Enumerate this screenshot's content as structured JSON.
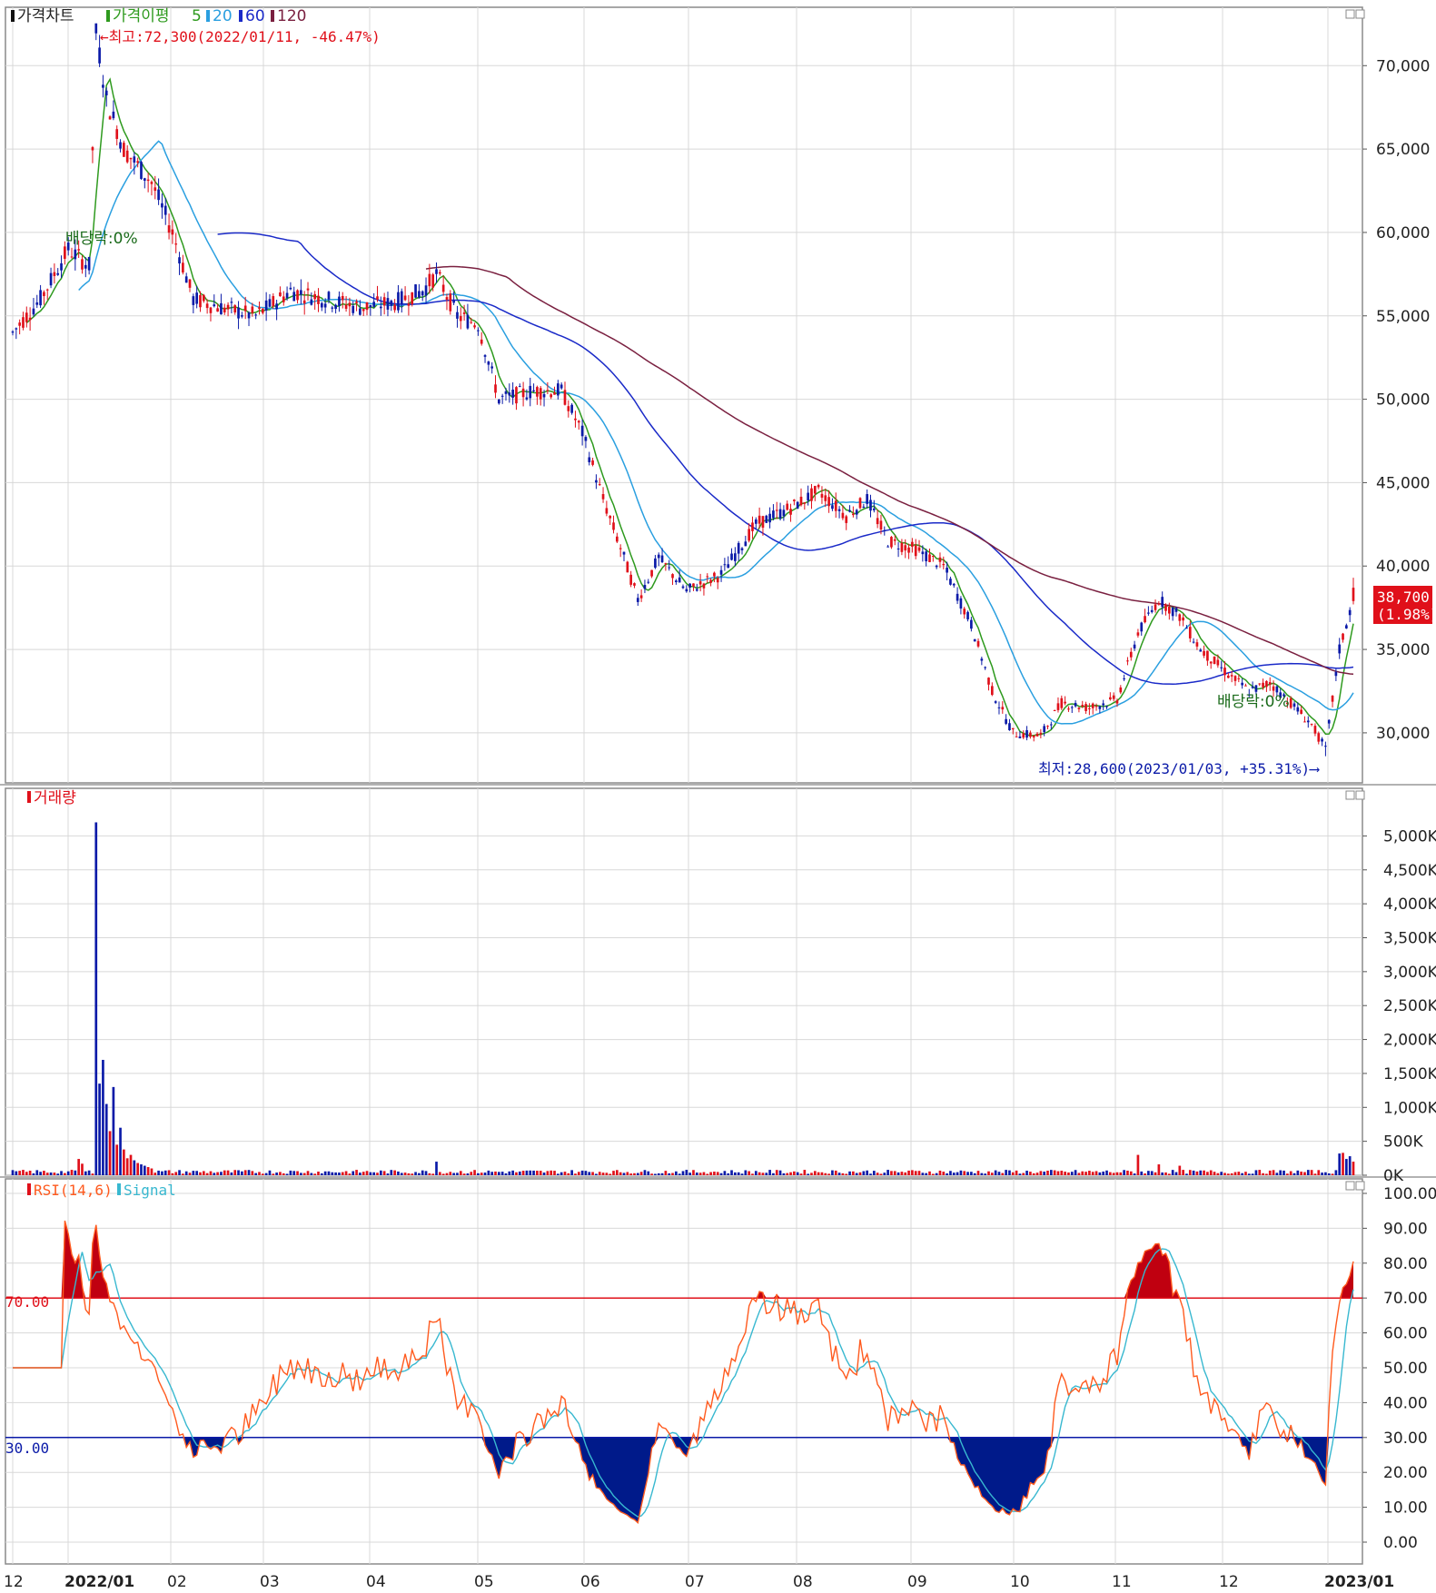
{
  "panels": {
    "price": {
      "legend": [
        "가격차트",
        "가격이평",
        "5",
        "20",
        "60",
        "120"
      ],
      "annotations": {
        "high": "←최고:72,300(2022/01/11, -46.47%)",
        "low": "최저:28,600(2023/01/03, +35.31%)⟶",
        "dividend1": "배당락:0%",
        "dividend2": "배당락:0%"
      },
      "last_price": "38,700",
      "last_change": "(1.98%)",
      "y_ticks": [
        "70,000",
        "65,000",
        "60,000",
        "55,000",
        "50,000",
        "45,000",
        "40,000",
        "35,000",
        "30,000"
      ]
    },
    "volume": {
      "legend": [
        "거래량"
      ],
      "y_ticks": [
        "5,000K",
        "4,500K",
        "4,000K",
        "3,500K",
        "3,000K",
        "2,500K",
        "2,000K",
        "1,500K",
        "1,000K",
        "500K",
        "0K"
      ]
    },
    "rsi": {
      "legend": [
        "RSI(14,6)",
        "Signal"
      ],
      "level_high": "70.00",
      "level_low": "30.00",
      "y_ticks": [
        "100.00",
        "90.00",
        "80.00",
        "70.00",
        "60.00",
        "50.00",
        "40.00",
        "30.00",
        "20.00",
        "10.00",
        "0.00"
      ]
    }
  },
  "x_labels": [
    "12",
    "2022/01",
    "02",
    "03",
    "04",
    "05",
    "06",
    "07",
    "08",
    "09",
    "10",
    "11",
    "12",
    "2023/01"
  ],
  "colors": {
    "up": "#e0101a",
    "down": "#0a1aa8",
    "ma5": "#2e9a1e",
    "ma20": "#2a9fe0",
    "ma60": "#1a2ac8",
    "ma120": "#7a2040",
    "grid": "#d8d8d8",
    "rsi": "#ff5a1e",
    "signal": "#38b8d0"
  },
  "chart_data": [
    {
      "type": "candlestick",
      "title": "가격차트",
      "period": [
        "2021/12",
        "2023/01"
      ],
      "ylim": [
        27000,
        73500
      ],
      "series": [
        {
          "name": "가격차트",
          "x": [
            "2021-12",
            "2022-01-11",
            "2022-02",
            "2022-03",
            "2022-04",
            "2022-05",
            "2022-06",
            "2022-07",
            "2022-08",
            "2022-09",
            "2022-10",
            "2022-11",
            "2022-12",
            "2023-01-03",
            "2023-01"
          ],
          "values": [
            54000,
            72300,
            56000,
            55500,
            56500,
            54000,
            41000,
            40500,
            44500,
            41000,
            29500,
            38500,
            33000,
            28600,
            38700
          ]
        },
        {
          "name": "5",
          "values": [
            54200,
            67000,
            57000,
            55700,
            56000,
            52500,
            40000,
            39500,
            44000,
            41500,
            30000,
            36500,
            32500,
            30500,
            35500
          ]
        },
        {
          "name": "20",
          "values": [
            54500,
            62000,
            63000,
            55500,
            56000,
            55000,
            46000,
            39500,
            42000,
            43000,
            32000,
            34000,
            34500,
            32000,
            33000
          ]
        },
        {
          "name": "60",
          "values": [
            null,
            null,
            59500,
            59300,
            58500,
            56500,
            50500,
            45500,
            42500,
            41000,
            37500,
            35000,
            33500,
            33000,
            33500
          ]
        },
        {
          "name": "120",
          "values": [
            null,
            null,
            null,
            null,
            null,
            57700,
            56800,
            54500,
            50000,
            48000,
            44500,
            39500,
            36800,
            36300,
            36200
          ]
        }
      ]
    },
    {
      "type": "bar",
      "title": "거래량",
      "ylim": [
        0,
        5200
      ],
      "unit": "K",
      "x": [
        "2022-01-11",
        "2022-01-12",
        "2022-01-13",
        "2022-01-17",
        "2022-04-20",
        "2022-11-10",
        "2023-01"
      ],
      "values": [
        5200,
        1350,
        1700,
        1300,
        200,
        300,
        330
      ]
    },
    {
      "type": "line",
      "title": "RSI(14,6)",
      "ylim": [
        0,
        100
      ],
      "levels": [
        70,
        30
      ],
      "series": [
        {
          "name": "RSI(14,6)",
          "values": [
            34,
            81,
            46,
            33,
            59,
            68,
            12,
            18,
            33,
            79,
            39,
            14,
            87,
            21,
            30,
            71
          ]
        },
        {
          "name": "Signal",
          "values": [
            33,
            73,
            55,
            32,
            52,
            60,
            25,
            15,
            40,
            75,
            45,
            20,
            80,
            24,
            31,
            56
          ]
        }
      ]
    }
  ]
}
